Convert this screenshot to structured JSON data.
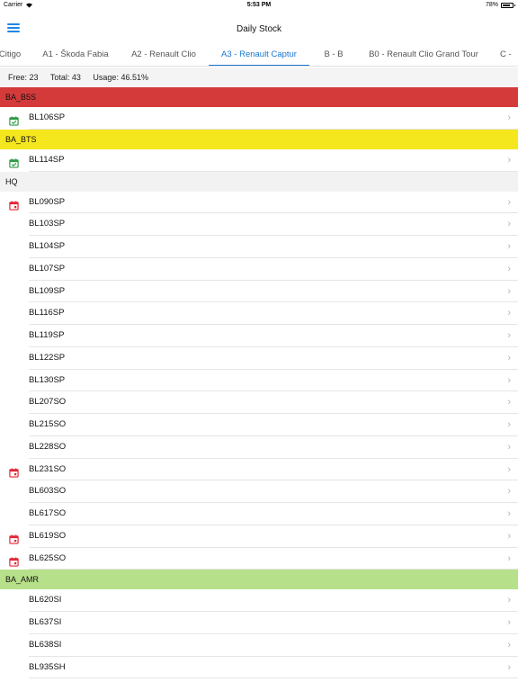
{
  "status_bar": {
    "carrier": "Carrier",
    "time": "5:53 PM",
    "battery": "78%",
    "battery_level": 0.78
  },
  "header": {
    "title": "Daily Stock"
  },
  "tabs": [
    {
      "label": "Citigo"
    },
    {
      "label": "A1 - Škoda Fabia"
    },
    {
      "label": "A2 - Renault Clio"
    },
    {
      "label": "A3 - Renault Captur",
      "active": true
    },
    {
      "label": "B - B"
    },
    {
      "label": "B0 - Renault Clio Grand Tour"
    },
    {
      "label": "C -"
    }
  ],
  "summary": {
    "free": "Free: 23",
    "total": "Total: 43",
    "usage": "Usage: 46.51%"
  },
  "colors": {
    "ba_b5s": "#d43a3a",
    "ba_bts": "#f5e71e",
    "hq": "#f2f2f2",
    "ba_amr": "#b7e08a",
    "accent": "#1976d2",
    "check_icon": "#2e9a44",
    "calendar_icon": "#e32636"
  },
  "sections": [
    {
      "title": "BA_B5S",
      "color": "#d43a3a",
      "rows": [
        {
          "code": "BL106SP",
          "icon": "calendar-check-icon"
        }
      ]
    },
    {
      "title": "BA_BTS",
      "color": "#f5e71e",
      "rows": [
        {
          "code": "BL114SP",
          "icon": "calendar-check-icon"
        }
      ]
    },
    {
      "title": "HQ",
      "color": "#f2f2f2",
      "rows": [
        {
          "code": "BL090SP",
          "icon": "calendar-icon"
        },
        {
          "code": "BL103SP"
        },
        {
          "code": "BL104SP"
        },
        {
          "code": "BL107SP"
        },
        {
          "code": "BL109SP"
        },
        {
          "code": "BL116SP"
        },
        {
          "code": "BL119SP"
        },
        {
          "code": "BL122SP"
        },
        {
          "code": "BL130SP"
        },
        {
          "code": "BL207SO"
        },
        {
          "code": "BL215SO"
        },
        {
          "code": "BL228SO"
        },
        {
          "code": "BL231SO",
          "icon": "calendar-icon"
        },
        {
          "code": "BL603SO"
        },
        {
          "code": "BL617SO"
        },
        {
          "code": "BL619SO",
          "icon": "calendar-icon"
        },
        {
          "code": "BL625SO",
          "icon": "calendar-icon"
        }
      ]
    },
    {
      "title": "BA_AMR",
      "color": "#b7e08a",
      "rows": [
        {
          "code": "BL620SI"
        },
        {
          "code": "BL637SI"
        },
        {
          "code": "BL638SI"
        },
        {
          "code": "BL935SH"
        }
      ]
    }
  ]
}
